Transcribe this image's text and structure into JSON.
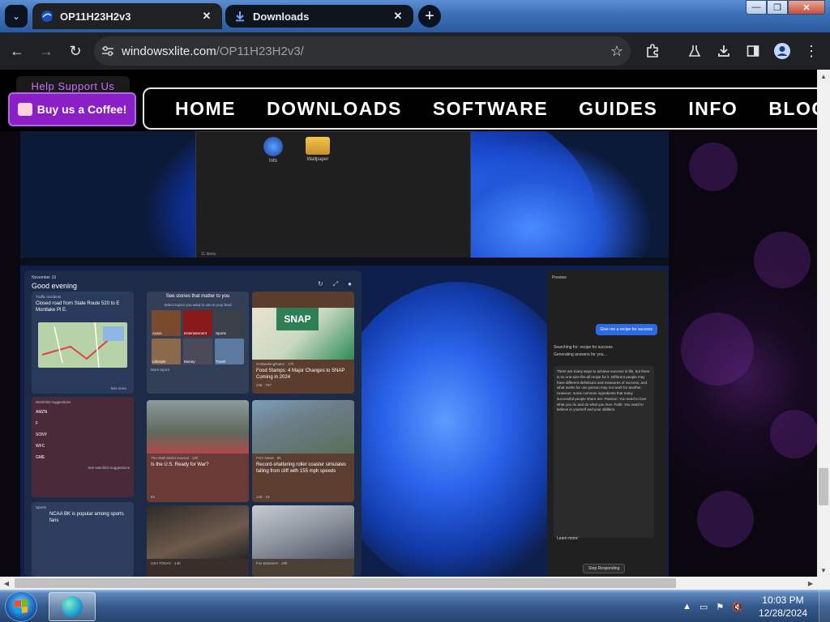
{
  "browser": {
    "tabs": [
      {
        "title": "OP11H23H2v3",
        "close": "✕"
      },
      {
        "title": "Downloads",
        "close": "✕"
      }
    ],
    "new_tab": "+",
    "url_domain": "windowsxlite.com",
    "url_path": "/OP11H23H2v3/",
    "window_controls": {
      "minimize": "—",
      "restore": "❐",
      "close": "✕"
    }
  },
  "site": {
    "help_label": "Help Support Us",
    "coffee_button": "Buy us a Coffee!",
    "nav": [
      "HOME",
      "DOWNLOADS",
      "SOFTWARE",
      "GUIDES",
      "INFO",
      "BLOG"
    ]
  },
  "screenshot_top": {
    "files": [
      {
        "label": "Info"
      },
      {
        "label": "Wallpaper"
      }
    ],
    "status": "11 items"
  },
  "screenshot_widgets": {
    "date": "November 19",
    "greeting": "Good evening",
    "traffic": {
      "header": "Traffic incidents",
      "text": "Closed road from State Route 520 to E Montlake Pl E.",
      "link": "See more"
    },
    "stories": {
      "title": "See stories that matter to you",
      "subtitle": "Select topics you want to see in your feed",
      "topics": [
        "Autos",
        "Entertainment",
        "Sports",
        "Lifestyle",
        "Money",
        "Travel"
      ],
      "more": "More topics"
    },
    "news1": {
      "source": "GOBankingRates · 17h",
      "title": "Food Stamps: 4 Major Changes to SNAP Coming in 2024",
      "likes": "236",
      "comments": "787"
    },
    "watchlist": {
      "header": "Watchlist suggestions",
      "stocks": [
        "AMZN",
        "F",
        "SONY",
        "WFC",
        "GME"
      ],
      "link": "See watchlist suggestions"
    },
    "news2": {
      "source": "The Wall Street Journal · 12h",
      "title": "Is the U.S. Ready for War?",
      "likes": "84"
    },
    "news3": {
      "source": "FOX News · 8h",
      "title": "Record-shattering roller coaster simulates falling from cliff with 155 mph speeds",
      "likes": "148",
      "comments": "19"
    },
    "sports": {
      "header": "Sports",
      "title": "NCAA BK is popular among sports fans"
    },
    "news4": {
      "source": "USA TODAY · 14h"
    },
    "news5": {
      "source": "Fox Business · 19h"
    }
  },
  "screenshot_preview": {
    "title": "Preview",
    "prompt": "Give me a recipe for success",
    "searching": "Searching for: recipe for success",
    "generating": "Generating answers for you...",
    "answer": "There are many ways to achieve success in life, but there is no one-size-fits-all recipe for it. Different people may have different definitions and measures of success, and what works for one person may not work for another. However, some common ingredients that many successful people share are: Passion: You need to love what you do and do what you love. Faith: You need to believe in yourself and your abilities.",
    "learn_more": "Learn more:",
    "stop": "Stop Responding"
  },
  "taskbar": {
    "time": "10:03 PM",
    "date": "12/28/2024"
  }
}
